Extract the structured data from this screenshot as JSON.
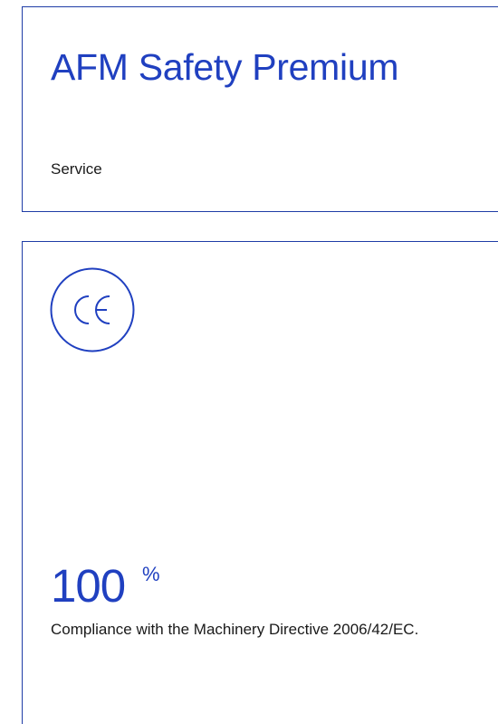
{
  "header": {
    "title": "AFM Safety Premium",
    "subtitle": "Service"
  },
  "stat": {
    "icon": "ce-mark-icon",
    "value": "100",
    "unit": "%",
    "caption": "Compliance with the Machinery Directive 2006/42/EC."
  },
  "colors": {
    "accent": "#2040c0",
    "border": "#1f3da6",
    "text": "#1a1a1a"
  }
}
